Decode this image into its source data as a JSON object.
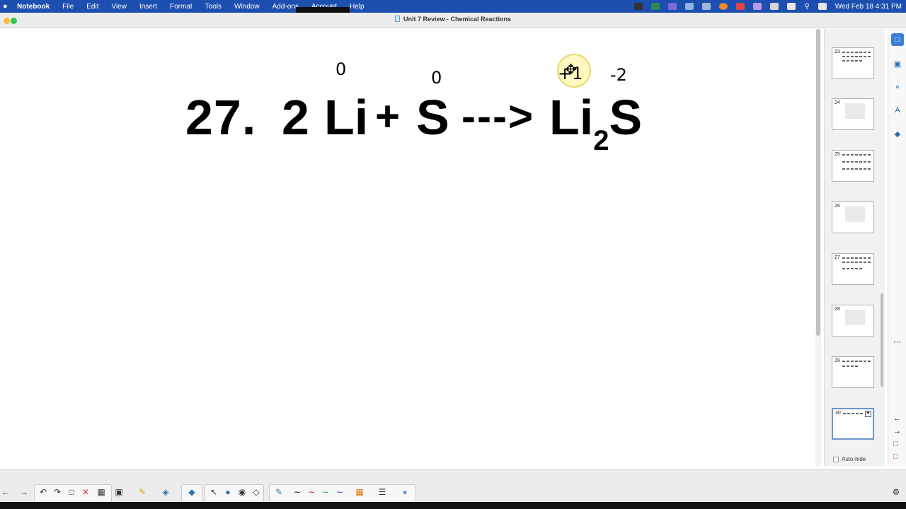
{
  "menubar": {
    "app_name": "Notebook",
    "items": [
      "File",
      "Edit",
      "View",
      "Insert",
      "Format",
      "Tools",
      "Window",
      "Add-ons",
      "Account",
      "Help"
    ],
    "clock": "Wed Feb 18  4:31 PM"
  },
  "window": {
    "title": "Unit 7 Review - Chemical Reactions"
  },
  "slide": {
    "question_number": "27.",
    "coefficient": "2",
    "reactant_1": "Li",
    "plus": "+",
    "reactant_2": "S",
    "arrow": "--->",
    "product_main": "Li",
    "product_subscript": "2",
    "product_end": "S",
    "ox_li": "0",
    "ox_s": "0",
    "ox_li_product": "+1",
    "ox_s_product": "-2"
  },
  "pages": [
    {
      "num": "23",
      "style": "text"
    },
    {
      "num": "24",
      "style": "gray"
    },
    {
      "num": "25",
      "style": "text"
    },
    {
      "num": "26",
      "style": "gray"
    },
    {
      "num": "27",
      "style": "text"
    },
    {
      "num": "28",
      "style": "gray"
    },
    {
      "num": "29",
      "style": "text"
    },
    {
      "num": "30",
      "style": "text",
      "selected": true
    }
  ],
  "sidepanel": {
    "autohide_label": "Auto-hide"
  },
  "colors": {
    "menubar": "#1d4fb0",
    "selection": "#6c94cf",
    "active_tab": "#3a7ed8",
    "pen_black": "#111111",
    "pen_red": "#cc2222",
    "pen_green": "#2a9a2a",
    "pen_blue": "#1f3fb5"
  }
}
